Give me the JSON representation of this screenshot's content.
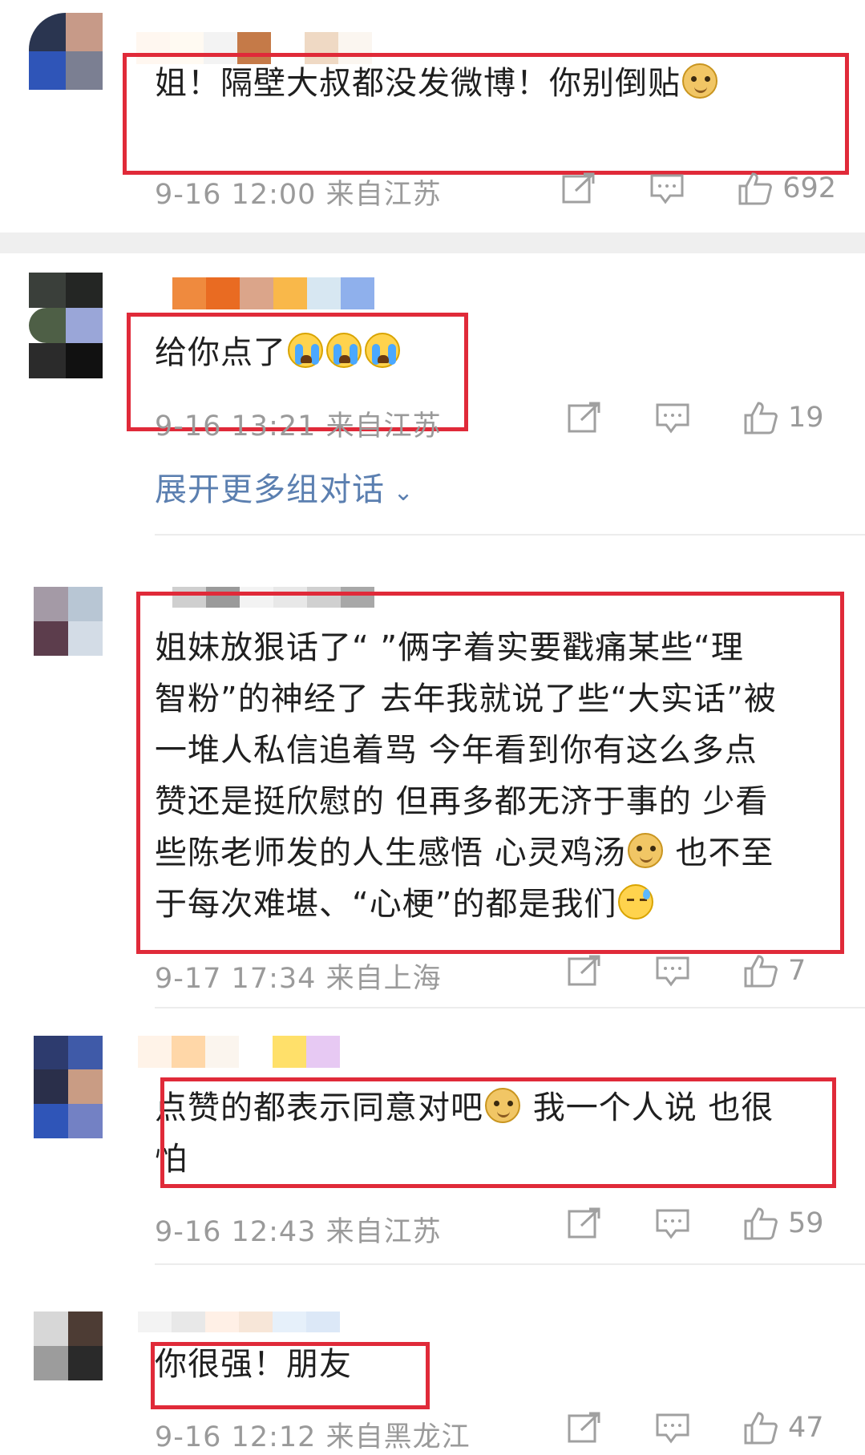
{
  "colors": {
    "highlight": "#e02a39",
    "meta": "#9a9a9a",
    "link": "#5b7fb0"
  },
  "comments": [
    {
      "text": "姐！隔壁大叔都没发微博！你别倒贴",
      "emoji": "doge-icon",
      "time": "9-16 12:00",
      "location": "来自江苏",
      "likes": "692"
    },
    {
      "text": "给你点了",
      "emoji": "crying-icon",
      "time": "9-16 13:21",
      "location": "来自江苏",
      "likes": "19",
      "expand": "展开更多组对话"
    },
    {
      "lines": [
        "姐妹放狠话了“  ”俩字着实要戳痛某些“理",
        "智粉”的神经了 去年我就说了些“大实话”被",
        "一堆人私信追着骂 今年看到你有这么多点",
        "赞还是挺欣慰的 但再多都无济于事的 少看",
        "些陈老师发的人生感悟 心灵鸡汤",
        "也不至",
        "于每次难堪、“心梗”的都是我们"
      ],
      "time": "9-17 17:34",
      "location": "来自上海",
      "likes": "7"
    },
    {
      "lines": [
        "点赞的都表示同意对吧",
        "我一个人说 也很",
        "怕"
      ],
      "time": "9-16 12:43",
      "location": "来自江苏",
      "likes": "59"
    },
    {
      "text": "你很强！朋友",
      "time": "9-16 12:12",
      "location": "来自黑龙江",
      "likes": "47"
    }
  ]
}
